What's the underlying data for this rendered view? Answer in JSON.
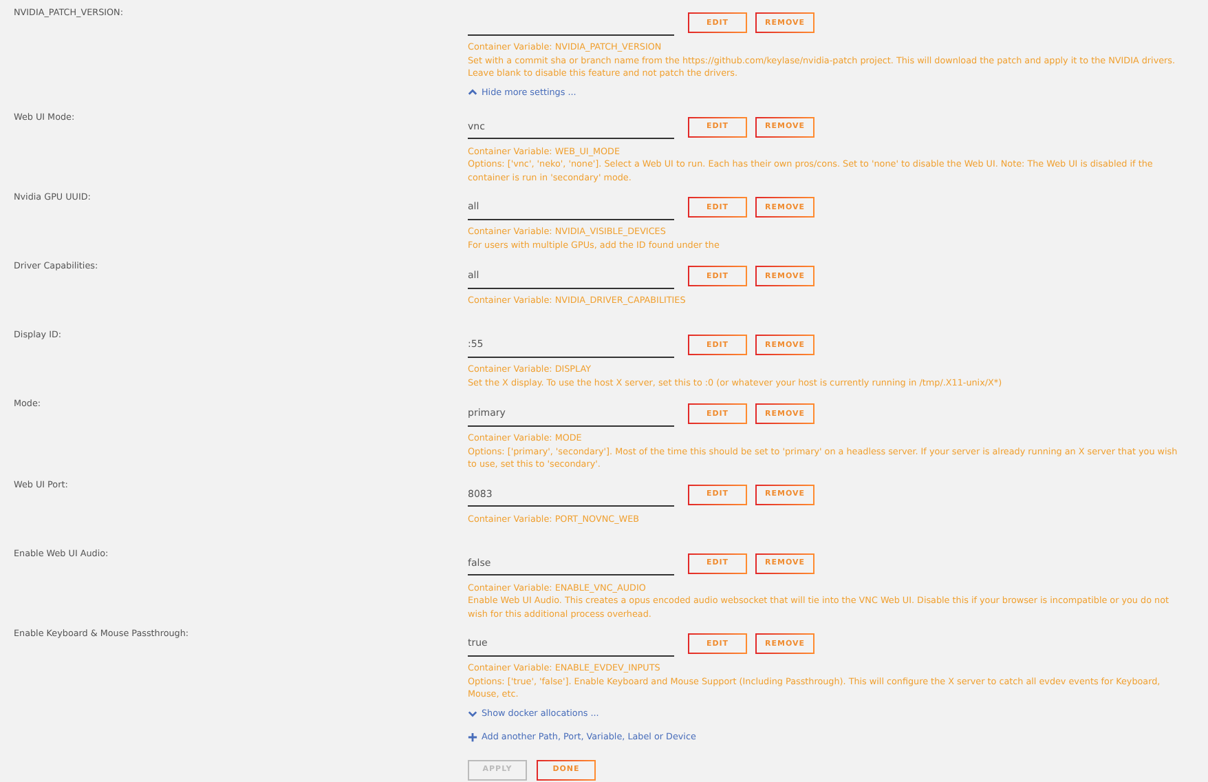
{
  "items": [
    {
      "kind": "setting",
      "label": "NVIDIA_PATCH_VERSION:",
      "value": "",
      "variable": "Container Variable: NVIDIA_PATCH_VERSION",
      "description": "Set with a commit sha or branch name from the https://github.com/keylase/nvidia-patch project. This will download the patch and apply it to the NVIDIA drivers. Leave blank to disable this feature and not patch the drivers.",
      "buttons": [
        "EDIT",
        "REMOVE"
      ]
    },
    {
      "kind": "collapse-link",
      "text": "Hide more settings ..."
    },
    {
      "kind": "setting",
      "label": "Web UI Mode:",
      "value": "vnc",
      "variable": "Container Variable: WEB_UI_MODE",
      "description": "Options: ['vnc', 'neko', 'none']. Select a Web UI to run. Each has their own pros/cons. Set to 'none' to disable the Web UI. Note: The Web UI is disabled if the container is run in 'secondary' mode.",
      "buttons": [
        "EDIT",
        "REMOVE"
      ]
    },
    {
      "kind": "setting",
      "label": "Nvidia GPU UUID:",
      "value": "all",
      "variable": "Container Variable: NVIDIA_VISIBLE_DEVICES",
      "description": "For users with multiple GPUs, add the ID found under the",
      "buttons": [
        "EDIT",
        "REMOVE"
      ]
    },
    {
      "kind": "setting",
      "label": "Driver Capabilities:",
      "value": "all",
      "variable": "Container Variable: NVIDIA_DRIVER_CAPABILITIES",
      "buttons": [
        "EDIT",
        "REMOVE"
      ]
    },
    {
      "kind": "setting",
      "label": "Display ID:",
      "value": ":55",
      "variable": "Container Variable: DISPLAY",
      "description": "Set the X display. To use the host X server, set this to :0 (or whatever your host is currently running in /tmp/.X11-unix/X*)",
      "buttons": [
        "EDIT",
        "REMOVE"
      ]
    },
    {
      "kind": "setting",
      "label": "Mode:",
      "value": "primary",
      "variable": "Container Variable: MODE",
      "description": "Options: ['primary', 'secondary']. Most of the time this should be set to 'primary' on a headless server. If your server is already running an X server that you wish to use, set this to 'secondary'.",
      "buttons": [
        "EDIT",
        "REMOVE"
      ]
    },
    {
      "kind": "setting",
      "label": "Web UI Port:",
      "value": "8083",
      "variable": "Container Variable: PORT_NOVNC_WEB",
      "buttons": [
        "EDIT",
        "REMOVE"
      ]
    },
    {
      "kind": "setting",
      "label": "Enable Web UI Audio:",
      "value": "false",
      "variable": "Container Variable: ENABLE_VNC_AUDIO",
      "description": "Enable Web UI Audio. This creates a opus encoded audio websocket that will tie into the VNC Web UI. Disable this if your browser is incompatible or you do not wish for this additional process overhead.",
      "buttons": [
        "EDIT",
        "REMOVE"
      ]
    },
    {
      "kind": "setting",
      "label": "Enable Keyboard & Mouse Passthrough:",
      "value": "true",
      "variable": "Container Variable: ENABLE_EVDEV_INPUTS",
      "description": "Options: ['true', 'false']. Enable Keyboard and Mouse Support (Including Passthrough). This will configure the X server to catch all evdev events for Keyboard, Mouse, etc.",
      "buttons": [
        "EDIT",
        "REMOVE"
      ]
    },
    {
      "kind": "expand-link",
      "text": "Show docker allocations ..."
    },
    {
      "kind": "add-link",
      "text": "Add another Path, Port, Variable, Label or Device"
    }
  ],
  "actions": [
    {
      "label": "APPLY",
      "disabled": true
    },
    {
      "label": "DONE",
      "disabled": false
    }
  ]
}
